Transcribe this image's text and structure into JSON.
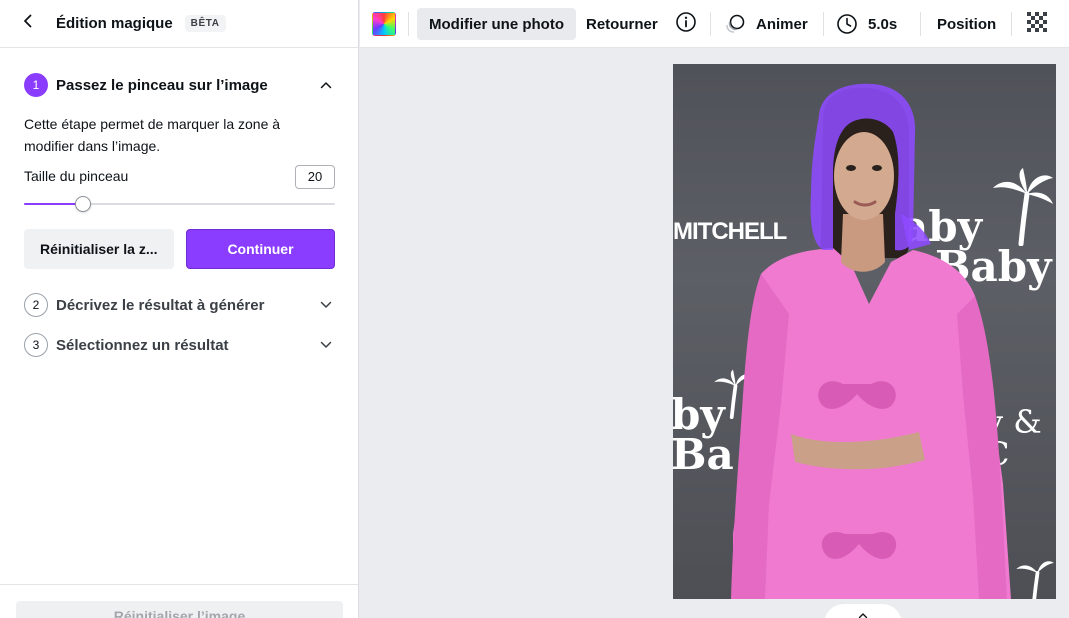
{
  "panel": {
    "title": "Édition magique",
    "badge": "BÊTA",
    "steps": [
      {
        "number": "1",
        "label": "Passez le pinceau sur l’image"
      },
      {
        "number": "2",
        "label": "Décrivez le résultat à générer"
      },
      {
        "number": "3",
        "label": "Sélectionnez un résultat"
      }
    ],
    "description": "Cette étape permet de marquer la zone à modifier dans l’image.",
    "brush_label": "Taille du pinceau",
    "brush_value": "20",
    "brush_level": 0.19,
    "reset_label": "Réinitialiser la z...",
    "continue_label": "Continuer",
    "footer_label": "Réinitialiser l’image"
  },
  "toolbar": {
    "edit_photo": "Modifier une photo",
    "flip": "Retourner",
    "animate": "Animer",
    "duration": "5.0s",
    "position": "Position"
  },
  "canvas": {
    "wall_text_1": "MITCHELL",
    "wall_text_2": "aby",
    "wall_text_3": "Baby",
    "wall_text_4": "by",
    "wall_text_5": "Ba",
    "wall_text_6": "y & C"
  },
  "colors": {
    "accent": "#8b3dff",
    "brush_mask": "#8e4bff",
    "outfit": "#f07ad0"
  }
}
